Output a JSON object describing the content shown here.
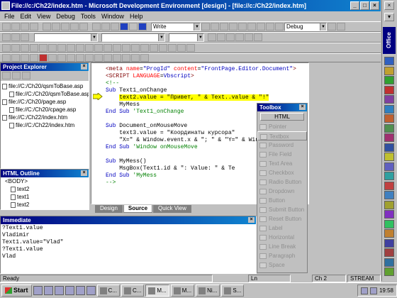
{
  "window": {
    "title": "File://c:/Ch22/index.htm - Microsoft Development Environment [design] - [file://c:/Ch22/index.htm]"
  },
  "menu": [
    "File",
    "Edit",
    "View",
    "Debug",
    "Tools",
    "Window",
    "Help"
  ],
  "toolbar": {
    "mode_combo": "Write",
    "config_combo": "Debug"
  },
  "project_explorer": {
    "title": "Project Explorer",
    "files": [
      "file://C:/Ch20/qsmToBase.asp",
      "file://C:/Ch20/qsmToBase.asp",
      "file://C:/Ch20/page.asp",
      "file://C:/Ch20/cpage.asp",
      "file://C:/Ch22/index.htm",
      "file://C:/Ch22/index.htm"
    ]
  },
  "html_outline": {
    "title": "HTML Outline",
    "items": [
      "<BODY>",
      "text2",
      "text1",
      "text2"
    ]
  },
  "editor": {
    "lines": [
      {
        "indent": "",
        "parts": [
          {
            "c": "tag",
            "t": "<meta "
          },
          {
            "c": "attr",
            "t": "name"
          },
          {
            "c": "",
            "t": "="
          },
          {
            "c": "kw",
            "t": "\"ProgId\""
          },
          {
            "c": "attr",
            "t": " content"
          },
          {
            "c": "",
            "t": "="
          },
          {
            "c": "kw",
            "t": "\"FrontPage.Editor.Document\""
          },
          {
            "c": "tag",
            "t": ">"
          }
        ]
      },
      {
        "indent": "",
        "parts": [
          {
            "c": "tag",
            "t": "<SCRIPT "
          },
          {
            "c": "attr",
            "t": "LANGUAGE"
          },
          {
            "c": "",
            "t": "="
          },
          {
            "c": "kw",
            "t": "Vbscript"
          },
          {
            "c": "tag",
            "t": ">"
          }
        ]
      },
      {
        "indent": "",
        "parts": [
          {
            "c": "cmt",
            "t": "<!--"
          }
        ]
      },
      {
        "indent": "",
        "parts": [
          {
            "c": "kw",
            "t": "Sub "
          },
          {
            "c": "",
            "t": "Text1_onChange"
          }
        ]
      },
      {
        "indent": "    ",
        "hl": true,
        "parts": [
          {
            "c": "",
            "t": "text2.value = \"Привет, \" & Text..value & \"!\""
          }
        ]
      },
      {
        "indent": "    ",
        "parts": [
          {
            "c": "",
            "t": "MyMess"
          }
        ]
      },
      {
        "indent": "",
        "parts": [
          {
            "c": "kw",
            "t": "End Sub "
          },
          {
            "c": "cmt",
            "t": "'Text1_onChange"
          }
        ]
      },
      {
        "indent": "",
        "parts": [
          {
            "c": "",
            "t": ""
          }
        ]
      },
      {
        "indent": "",
        "parts": [
          {
            "c": "kw",
            "t": "Sub "
          },
          {
            "c": "",
            "t": "Document_onMouseMove"
          }
        ]
      },
      {
        "indent": "    ",
        "parts": [
          {
            "c": "",
            "t": "text3.value = \"Координаты курсора\""
          }
        ]
      },
      {
        "indent": "    ",
        "parts": [
          {
            "c": "",
            "t": "\"X=\" & Window.event.x & \"; \" & \"Y=\" & Window.event.Y"
          }
        ]
      },
      {
        "indent": "",
        "parts": [
          {
            "c": "kw",
            "t": "End Sub "
          },
          {
            "c": "cmt",
            "t": "'Window onMouseMove"
          }
        ]
      },
      {
        "indent": "",
        "parts": [
          {
            "c": "",
            "t": ""
          }
        ]
      },
      {
        "indent": "",
        "parts": [
          {
            "c": "kw",
            "t": "Sub "
          },
          {
            "c": "",
            "t": "MyMess()"
          }
        ]
      },
      {
        "indent": "    ",
        "parts": [
          {
            "c": "",
            "t": "MsgBox(Text1.id & \": Value: \" & Te"
          }
        ]
      },
      {
        "indent": "",
        "parts": [
          {
            "c": "kw",
            "t": "End Sub "
          },
          {
            "c": "cmt",
            "t": "'MyMess"
          }
        ]
      },
      {
        "indent": "",
        "parts": [
          {
            "c": "cmt",
            "t": "-->"
          }
        ]
      }
    ],
    "tabs": [
      "Design",
      "Source",
      "Quick View"
    ],
    "active_tab": "Source"
  },
  "immediate": {
    "title": "Immediate",
    "lines": [
      "?Text1.value",
      "Vladimir",
      "Text1.value=\"Vlad\"",
      "?Text1.value",
      "Vlad"
    ]
  },
  "toolbox": {
    "title": "Toolbox",
    "tab": "HTML",
    "items": [
      "Pointer",
      "Textbox",
      "Password",
      "File Field",
      "Text Area",
      "Checkbox",
      "Radio Button",
      "Dropdown",
      "Button",
      "Submit Button",
      "Reset Button",
      "Label",
      "Horizontal",
      "Line Break",
      "Paragraph",
      "Space"
    ]
  },
  "office_bar": {
    "label": "Office"
  },
  "status": {
    "ready": "Ready",
    "ln": "Ln",
    "ch": "Ch 2",
    "mode": "STREAM  INS"
  },
  "taskbar": {
    "start": "Start",
    "tasks": [
      "C...",
      "C...",
      "M...",
      "M...",
      "Ni...",
      "S..."
    ],
    "clock": "19:58"
  }
}
